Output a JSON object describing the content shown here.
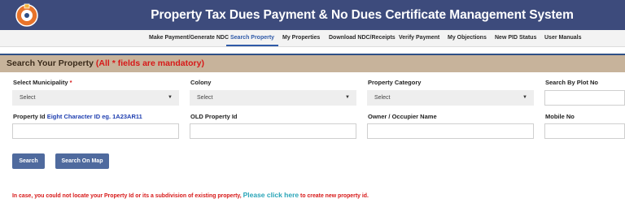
{
  "header": {
    "title": "Property Tax Dues Payment & No Dues Certificate Management System",
    "logo": "haryana-emblem-icon"
  },
  "nav": {
    "items": [
      {
        "label": "Make Payment/Generate NDC"
      },
      {
        "label": "Search Property"
      },
      {
        "label": "My Properties"
      },
      {
        "label": "Download NDC/Receipts"
      },
      {
        "label": "Verify Payment"
      },
      {
        "label": "My Objections"
      },
      {
        "label": "New PID Status"
      },
      {
        "label": "User Manuals"
      }
    ],
    "active": "Search Property"
  },
  "section": {
    "title": "Search Your Property",
    "mandatory_note": "(All * fields are mandatory)"
  },
  "form": {
    "municipality": {
      "label": "Select Municipality",
      "required_mark": "*",
      "value": "Select"
    },
    "colony": {
      "label": "Colony",
      "value": "Select"
    },
    "category": {
      "label": "Property Category",
      "value": "Select"
    },
    "plot": {
      "label": "Search By Plot No",
      "value": ""
    },
    "property_id": {
      "label": "Property Id",
      "hint": "Eight Character ID eg. 1A23AR11",
      "value": ""
    },
    "old_property_id": {
      "label": "OLD Property Id",
      "value": ""
    },
    "owner": {
      "label": "Owner / Occupier Name",
      "value": ""
    },
    "mobile": {
      "label": "Mobile No",
      "value": ""
    }
  },
  "buttons": {
    "search": "Search",
    "search_map": "Search On Map"
  },
  "note": {
    "prefix": "In case, you could not locate your Property Id or its a subdivision of existing property,",
    "link": "Please click here",
    "suffix": "to create new property id."
  },
  "colors": {
    "header_bg": "#3d4b7c",
    "section_bg": "#c7b39b",
    "button_bg": "#4f6a9e",
    "required": "#d71818",
    "link": "#2aa5b8"
  }
}
